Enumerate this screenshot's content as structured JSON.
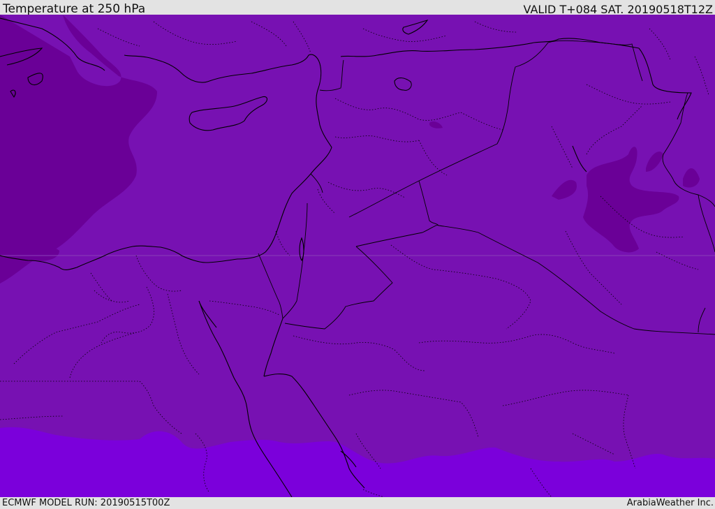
{
  "header": {
    "title": "Temperature at 250 hPa",
    "valid_time": "VALID T+084 SAT. 20190518T12Z"
  },
  "footer": {
    "model_run": "ECMWF MODEL RUN: 20190515T00Z",
    "credit": "ArabiaWeather Inc."
  },
  "map": {
    "field": "temperature",
    "level": "250 hPa",
    "colors": {
      "base": "#7711b2",
      "colder": "#6a0097",
      "warmer": "#7b00db",
      "coast": "#000000"
    }
  }
}
